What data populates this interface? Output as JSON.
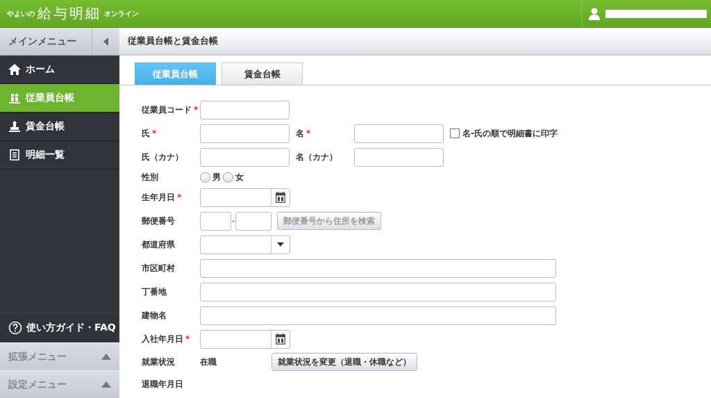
{
  "header": {
    "logo_small": "やよいの",
    "logo_main": "給与明細",
    "logo_suffix": "オンライン"
  },
  "sidebar": {
    "title": "メインメニュー",
    "items": [
      {
        "label": "ホーム",
        "selected": false
      },
      {
        "label": "従業員台帳",
        "selected": true
      },
      {
        "label": "賃金台帳",
        "selected": false
      },
      {
        "label": "明細一覧",
        "selected": false
      }
    ],
    "guide": "使い方ガイド・FAQ",
    "sections": [
      {
        "label": "拡張メニュー",
        "expanded": false
      },
      {
        "label": "設定メニュー",
        "expanded": false
      }
    ]
  },
  "page_title": "従業員台帳と賃金台帳",
  "tabs": [
    {
      "label": "従業員台帳",
      "selected": true
    },
    {
      "label": "賃金台帳",
      "selected": false
    }
  ],
  "rows": [
    {
      "kind": "input",
      "label": "従業員コード",
      "mark": "*"
    },
    {
      "kind": "pair",
      "label": "氏",
      "mark": "*",
      "second_label": "名",
      "second_mark": "*",
      "checkbox": {
        "label": "名-氏の順で明細書に印字",
        "checked": false
      }
    },
    {
      "kind": "pair",
      "label": "氏（カナ）",
      "second_label": "名（カナ）"
    },
    {
      "kind": "radio",
      "label": "性別",
      "options": [
        {
          "label": "男",
          "selected": false
        },
        {
          "label": "女",
          "selected": false
        }
      ]
    },
    {
      "kind": "date",
      "label": "生年月日",
      "mark": "*"
    },
    {
      "kind": "postal",
      "label": "郵便番号",
      "separator": "-",
      "button": {
        "label": "郵便番号から住所を検索",
        "disabled": true
      }
    },
    {
      "kind": "select",
      "label": "都道府県"
    },
    {
      "kind": "wide",
      "label": "市区町村"
    },
    {
      "kind": "wide",
      "label": "丁番地"
    },
    {
      "kind": "wide",
      "label": "建物名"
    },
    {
      "kind": "date",
      "label": "入社年月日",
      "mark": "*"
    },
    {
      "kind": "status",
      "label": "就業状況",
      "value": "在職",
      "button": {
        "label": "就業状況を変更（退職・休職など）",
        "disabled": false
      }
    },
    {
      "kind": "plain",
      "label": "退職年月日"
    }
  ]
}
